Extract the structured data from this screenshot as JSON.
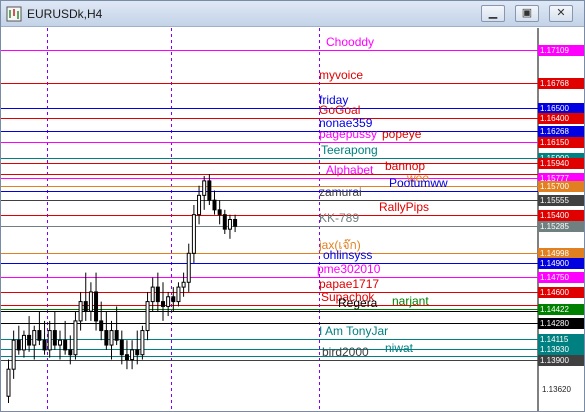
{
  "window": {
    "title": "EURUSDk,H4",
    "buttons": {
      "minimize": "▁",
      "maximize": "▣",
      "close": "✕"
    }
  },
  "chart": {
    "symbol": "EURUSDk",
    "timeframe": "H4",
    "ylim": [
      1.1345,
      1.1725
    ],
    "axis_labels": [
      "1.13620"
    ],
    "levels": [
      {
        "label": "Chooddy",
        "price": 1.17109,
        "price_text": "1.17109",
        "color": "#ff00ff"
      },
      {
        "label": "myvoice",
        "price": 1.16768,
        "price_text": "1.16768",
        "color": "#e00000"
      },
      {
        "label": "friday",
        "price": 1.165,
        "price_text": "1.16500",
        "color": "#0000e0"
      },
      {
        "label": "GoGoal",
        "price": 1.164,
        "price_text": "1.16400",
        "color": "#e00000"
      },
      {
        "label": "nonae359",
        "price": 1.16268,
        "price_text": "1.16268",
        "color": "#0000e0"
      },
      {
        "label": "popeye",
        "price": 1.1615,
        "price_text": "1.16150",
        "color": "#e00000"
      },
      {
        "label": "pagepussy",
        "price": 1.1615,
        "price_text": "",
        "color": "#ff00ff"
      },
      {
        "label": "Teerapong",
        "price": 1.1599,
        "price_text": "1.15990",
        "color": "#008080"
      },
      {
        "label": "",
        "price": 1.1594,
        "price_text": "1.15940",
        "color": "#e00000"
      },
      {
        "label": "bannop",
        "price": 1.1582,
        "price_text": "",
        "color": "#e00000"
      },
      {
        "label": "Alphabet",
        "price": 1.15777,
        "price_text": "1.15777",
        "color": "#ff00ff"
      },
      {
        "label": "wee",
        "price": 1.157,
        "price_text": "1.15700",
        "color": "#e08020"
      },
      {
        "label": "Pootumww",
        "price": 1.1564,
        "price_text": "",
        "color": "#0000e0"
      },
      {
        "label": "zamurai",
        "price": 1.15555,
        "price_text": "1.15555",
        "color": "#404040"
      },
      {
        "label": "RallyPips",
        "price": 1.154,
        "price_text": "1.15400",
        "color": "#e00000"
      },
      {
        "label": "KK-789",
        "price": 1.15285,
        "price_text": "1.15285",
        "color": "#708080"
      },
      {
        "label": "jax(เจ๊ก)",
        "price": 1.14998,
        "price_text": "1.14998",
        "color": "#e08020"
      },
      {
        "label": "ohlinsyss",
        "price": 1.149,
        "price_text": "1.14900",
        "color": "#0000e0"
      },
      {
        "label": "pme302010",
        "price": 1.1475,
        "price_text": "1.14750",
        "color": "#ff00ff"
      },
      {
        "label": "papae1717",
        "price": 1.146,
        "price_text": "1.14600",
        "color": "#e00000"
      },
      {
        "label": "Supachok",
        "price": 1.1446,
        "price_text": "",
        "color": "#e00000"
      },
      {
        "label": "narjant",
        "price": 1.14422,
        "price_text": "1.14422",
        "color": "#008000"
      },
      {
        "label": "Regera",
        "price": 1.144,
        "price_text": "",
        "color": "#000000"
      },
      {
        "label": "",
        "price": 1.1428,
        "price_text": "1.14280",
        "color": "#000000"
      },
      {
        "label": "I Am TonyJar",
        "price": 1.14115,
        "price_text": "1.14115",
        "color": "#008080"
      },
      {
        "label": "",
        "price": 1.1401,
        "price_text": "1.13930",
        "color": "#008080"
      },
      {
        "label": "niwat",
        "price": 1.1394,
        "price_text": "",
        "color": "#008080"
      },
      {
        "label": "bird2000",
        "price": 1.139,
        "price_text": "1.13900",
        "color": "#404040"
      }
    ],
    "vlines": [
      {
        "color": "#8000ff"
      },
      {
        "color": "#8000ff"
      },
      {
        "color": "#8000ff"
      }
    ],
    "candles": [
      {
        "o": 1.1352,
        "h": 1.139,
        "l": 1.1345,
        "c": 1.138
      },
      {
        "o": 1.138,
        "h": 1.142,
        "l": 1.137,
        "c": 1.141
      },
      {
        "o": 1.141,
        "h": 1.1425,
        "l": 1.1395,
        "c": 1.14
      },
      {
        "o": 1.14,
        "h": 1.142,
        "l": 1.1392,
        "c": 1.1415
      },
      {
        "o": 1.1415,
        "h": 1.1435,
        "l": 1.1398,
        "c": 1.1405
      },
      {
        "o": 1.1405,
        "h": 1.1425,
        "l": 1.139,
        "c": 1.142
      },
      {
        "o": 1.142,
        "h": 1.144,
        "l": 1.1405,
        "c": 1.141
      },
      {
        "o": 1.141,
        "h": 1.143,
        "l": 1.1395,
        "c": 1.14
      },
      {
        "o": 1.14,
        "h": 1.143,
        "l": 1.1392,
        "c": 1.142
      },
      {
        "o": 1.142,
        "h": 1.144,
        "l": 1.14,
        "c": 1.1405
      },
      {
        "o": 1.1405,
        "h": 1.142,
        "l": 1.139,
        "c": 1.141
      },
      {
        "o": 1.141,
        "h": 1.143,
        "l": 1.1395,
        "c": 1.14
      },
      {
        "o": 1.14,
        "h": 1.1415,
        "l": 1.1385,
        "c": 1.1395
      },
      {
        "o": 1.1395,
        "h": 1.144,
        "l": 1.139,
        "c": 1.143
      },
      {
        "o": 1.143,
        "h": 1.146,
        "l": 1.142,
        "c": 1.145
      },
      {
        "o": 1.145,
        "h": 1.148,
        "l": 1.143,
        "c": 1.144
      },
      {
        "o": 1.144,
        "h": 1.147,
        "l": 1.143,
        "c": 1.146
      },
      {
        "o": 1.146,
        "h": 1.148,
        "l": 1.142,
        "c": 1.143
      },
      {
        "o": 1.143,
        "h": 1.145,
        "l": 1.141,
        "c": 1.142
      },
      {
        "o": 1.142,
        "h": 1.144,
        "l": 1.14,
        "c": 1.1405
      },
      {
        "o": 1.1405,
        "h": 1.143,
        "l": 1.139,
        "c": 1.142
      },
      {
        "o": 1.142,
        "h": 1.1445,
        "l": 1.1405,
        "c": 1.141
      },
      {
        "o": 1.141,
        "h": 1.142,
        "l": 1.1385,
        "c": 1.1395
      },
      {
        "o": 1.1395,
        "h": 1.141,
        "l": 1.138,
        "c": 1.139
      },
      {
        "o": 1.139,
        "h": 1.141,
        "l": 1.138,
        "c": 1.14
      },
      {
        "o": 1.14,
        "h": 1.142,
        "l": 1.1385,
        "c": 1.1395
      },
      {
        "o": 1.1395,
        "h": 1.1425,
        "l": 1.139,
        "c": 1.142
      },
      {
        "o": 1.142,
        "h": 1.146,
        "l": 1.141,
        "c": 1.145
      },
      {
        "o": 1.145,
        "h": 1.1475,
        "l": 1.144,
        "c": 1.1465
      },
      {
        "o": 1.1465,
        "h": 1.148,
        "l": 1.144,
        "c": 1.145
      },
      {
        "o": 1.145,
        "h": 1.147,
        "l": 1.143,
        "c": 1.1445
      },
      {
        "o": 1.1445,
        "h": 1.146,
        "l": 1.1435,
        "c": 1.1455
      },
      {
        "o": 1.1455,
        "h": 1.1465,
        "l": 1.144,
        "c": 1.145
      },
      {
        "o": 1.145,
        "h": 1.147,
        "l": 1.1445,
        "c": 1.1465
      },
      {
        "o": 1.1465,
        "h": 1.148,
        "l": 1.1455,
        "c": 1.147
      },
      {
        "o": 1.147,
        "h": 1.151,
        "l": 1.146,
        "c": 1.15
      },
      {
        "o": 1.15,
        "h": 1.155,
        "l": 1.149,
        "c": 1.154
      },
      {
        "o": 1.154,
        "h": 1.157,
        "l": 1.153,
        "c": 1.156
      },
      {
        "o": 1.156,
        "h": 1.158,
        "l": 1.1545,
        "c": 1.1575
      },
      {
        "o": 1.1575,
        "h": 1.1582,
        "l": 1.155,
        "c": 1.1555
      },
      {
        "o": 1.1555,
        "h": 1.1565,
        "l": 1.154,
        "c": 1.1545
      },
      {
        "o": 1.1545,
        "h": 1.1555,
        "l": 1.153,
        "c": 1.154
      },
      {
        "o": 1.154,
        "h": 1.1545,
        "l": 1.152,
        "c": 1.1525
      },
      {
        "o": 1.1525,
        "h": 1.154,
        "l": 1.1515,
        "c": 1.1535
      },
      {
        "o": 1.1535,
        "h": 1.154,
        "l": 1.1522,
        "c": 1.1528
      }
    ]
  }
}
